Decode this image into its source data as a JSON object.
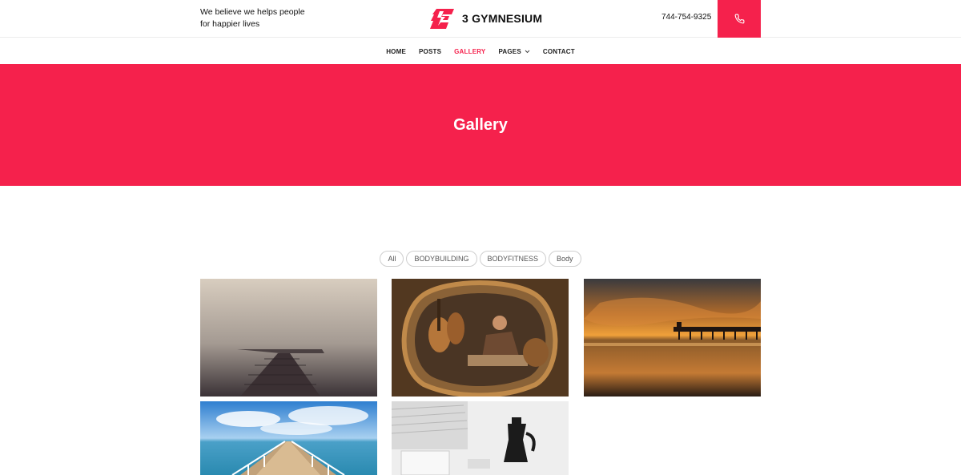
{
  "header": {
    "tagline_line1": "We believe we helps people",
    "tagline_line2": "for happier lives",
    "brand_name": "3 GYMNESIUM",
    "phone": "744-754-9325",
    "call_icon": "phone-icon",
    "logo_icon": "lightning-e-logo"
  },
  "nav": {
    "items": [
      {
        "label": "HOME"
      },
      {
        "label": "POSTS"
      },
      {
        "label": "GALLERY",
        "active": true
      },
      {
        "label": "PAGES",
        "has_dropdown": true
      },
      {
        "label": "CONTACT"
      }
    ]
  },
  "hero": {
    "title": "Gallery"
  },
  "gallery": {
    "filters": [
      {
        "label": "All"
      },
      {
        "label": "BODYBUILDING"
      },
      {
        "label": "BODYFITNESS"
      },
      {
        "label": "Body"
      }
    ],
    "images": [
      {
        "subject": "misty pier"
      },
      {
        "subject": "guitar workshop"
      },
      {
        "subject": "sunset pier"
      },
      {
        "subject": "boardwalk sea"
      },
      {
        "subject": "coffee pot desk"
      }
    ]
  },
  "colors": {
    "accent": "#f5214c",
    "text": "#111111",
    "border": "#cfcfcf"
  }
}
